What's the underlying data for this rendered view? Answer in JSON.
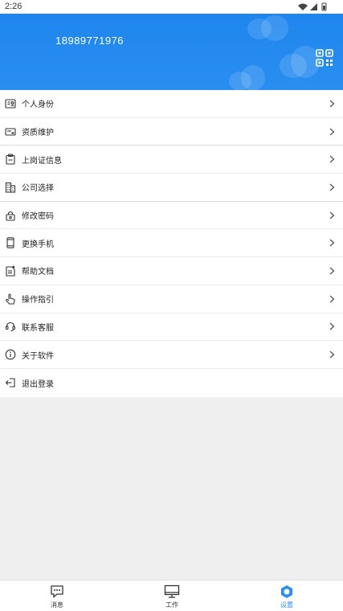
{
  "status": {
    "time": "2:26"
  },
  "header": {
    "phone": "18989771976",
    "qr_icon": "qr-code-icon"
  },
  "menu": [
    {
      "label": "个人身份",
      "icon": "id-card-icon",
      "chevron": true
    },
    {
      "label": "资质维护",
      "icon": "certificate-icon",
      "chevron": true
    },
    {
      "label": "上岗证信息",
      "icon": "clipboard-icon",
      "chevron": true
    },
    {
      "label": "公司选择",
      "icon": "building-icon",
      "chevron": true
    },
    {
      "label": "修改密码",
      "icon": "lock-icon",
      "chevron": true
    },
    {
      "label": "更换手机",
      "icon": "phone-icon",
      "chevron": true
    },
    {
      "label": "帮助文档",
      "icon": "document-icon",
      "chevron": true
    },
    {
      "label": "操作指引",
      "icon": "hand-pointer-icon",
      "chevron": true
    },
    {
      "label": "联系客服",
      "icon": "headset-icon",
      "chevron": true
    },
    {
      "label": "关于软件",
      "icon": "info-icon",
      "chevron": true
    },
    {
      "label": "退出登录",
      "icon": "logout-icon",
      "chevron": false
    }
  ],
  "nav": [
    {
      "label": "消息",
      "icon": "message-icon",
      "active": false
    },
    {
      "label": "工作",
      "icon": "monitor-icon",
      "active": false
    },
    {
      "label": "设置",
      "icon": "settings-icon",
      "active": true
    }
  ],
  "colors": {
    "accent": "#2a8ef0",
    "header": "#1e86ee"
  }
}
